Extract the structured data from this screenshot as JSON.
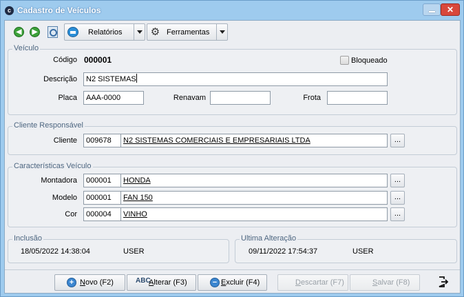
{
  "window": {
    "title": "Cadastro de Veículos",
    "close_glyph": "✕",
    "app_glyph": "c"
  },
  "toolbar": {
    "relatorios_label": "Relatórios",
    "ferramentas_label": "Ferramentas",
    "prev_glyph": "◀",
    "next_glyph": "▶"
  },
  "veiculo": {
    "group_title": "Veículo",
    "codigo_label": "Código",
    "codigo_value": "000001",
    "bloqueado_label": "Bloqueado",
    "bloqueado_checked": false,
    "descricao_label": "Descrição",
    "descricao_value": "N2 SISTEMAS",
    "placa_label": "Placa",
    "placa_value": "AAA-0000",
    "renavam_label": "Renavam",
    "renavam_value": "",
    "frota_label": "Frota",
    "frota_value": ""
  },
  "cliente": {
    "group_title": "Cliente Responsável",
    "label": "Cliente",
    "code": "009678",
    "name": "N2 SISTEMAS COMERCIAIS E EMPRESARIAIS LTDA",
    "lookup_label": "..."
  },
  "caracteristicas": {
    "group_title": "Características Veículo",
    "rows": [
      {
        "label": "Montadora",
        "code": "000001",
        "name": "HONDA",
        "lookup_label": "..."
      },
      {
        "label": "Modelo",
        "code": "000001",
        "name": "FAN 150",
        "lookup_label": "..."
      },
      {
        "label": "Cor",
        "code": "000004",
        "name": "VINHO",
        "lookup_label": "..."
      }
    ]
  },
  "inclusao": {
    "group_title": "Inclusão",
    "datetime": "18/05/2022 14:38:04",
    "user": "USER"
  },
  "alteracao": {
    "group_title": "Ultima Alteração",
    "datetime": "09/11/2022 17:54:37",
    "user": "USER"
  },
  "actions": {
    "novo_u": "N",
    "novo_rest": "ovo (F2)",
    "alterar_u": "A",
    "alterar_rest": "lterar (F3)",
    "excluir_u": "E",
    "excluir_rest": "xcluir (F4)",
    "descartar_u": "D",
    "descartar_rest": "escartar (F7)",
    "salvar_u": "S",
    "salvar_rest": "alvar (F8)",
    "abc_glyph": "ABC"
  },
  "colors": {
    "titlebar": "#9ecbee",
    "client_bg": "#eceef2",
    "group_title": "#4d6680",
    "close_red": "#d8483c",
    "nav_green": "#3ca13a",
    "icon_blue": "#3b86d0"
  }
}
